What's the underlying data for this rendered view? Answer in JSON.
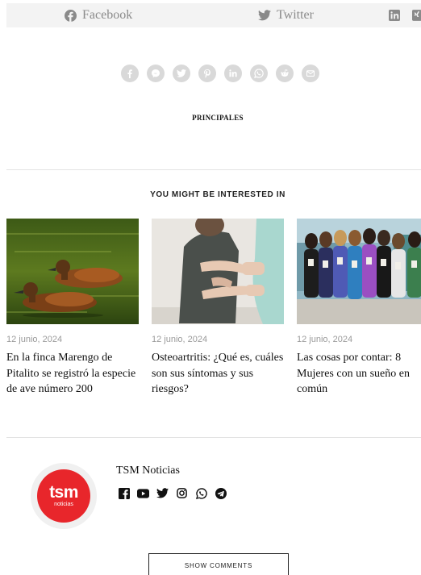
{
  "share_bar": {
    "facebook_label": "Facebook",
    "twitter_label": "Twitter",
    "icons": [
      "facebook-icon",
      "twitter-icon",
      "linkedin-icon",
      "xing-icon"
    ]
  },
  "social_circles": [
    "facebook-icon",
    "messenger-icon",
    "twitter-icon",
    "pinterest-icon",
    "linkedin-icon",
    "whatsapp-icon",
    "reddit-icon",
    "email-icon"
  ],
  "tags": {
    "label": "PRINCIPALES"
  },
  "related": {
    "heading": "YOU MIGHT BE INTERESTED IN",
    "cards": [
      {
        "date": "12 junio, 2024",
        "title": "En la finca Marengo de Pitalito se registró la especie de ave número 200",
        "image": "ducks-on-pond"
      },
      {
        "date": "12 junio, 2024",
        "title": "Osteoartritis: ¿Qué es, cuáles son sus síntomas y sus riesgos?",
        "image": "back-pain-therapy"
      },
      {
        "date": "12 junio, 2024",
        "title": "Las cosas por contar: 8 Mujeres con un sueño en común",
        "image": "group-of-women-with-books"
      }
    ]
  },
  "author": {
    "name": "TSM Noticias",
    "logo_text": "tsm",
    "logo_sub": "noticias",
    "icons": [
      "facebook-icon",
      "youtube-icon",
      "twitter-icon",
      "instagram-icon",
      "whatsapp-icon",
      "telegram-icon"
    ]
  },
  "comments": {
    "button_label": "SHOW COMMENTS"
  },
  "colors": {
    "brand_red": "#e8262b",
    "muted": "#8a8a8a",
    "circle_bg": "#d9d9d9"
  }
}
